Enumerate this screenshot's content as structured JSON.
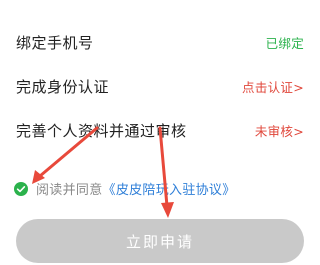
{
  "rows": [
    {
      "label": "绑定手机号",
      "status": "已绑定",
      "status_color": "#2bb24c"
    },
    {
      "label": "完成身份认证",
      "status": "点击认证>",
      "status_color": "#e0463a"
    },
    {
      "label": "完善个人资料并通过审核",
      "status": "未审核>",
      "status_color": "#e0463a"
    }
  ],
  "agreement": {
    "prefix": "阅读并同意",
    "link": "《皮皮陪玩入驻协议》",
    "checked": true,
    "check_icon": "check-circle-icon"
  },
  "submit": {
    "label": "立即申请"
  },
  "colors": {
    "accent_green": "#2bb24c",
    "warning_red": "#e0463a",
    "link_blue": "#2f7fd8",
    "button_disabled": "#c9c9c9",
    "annotation_arrow": "#e8493b"
  }
}
